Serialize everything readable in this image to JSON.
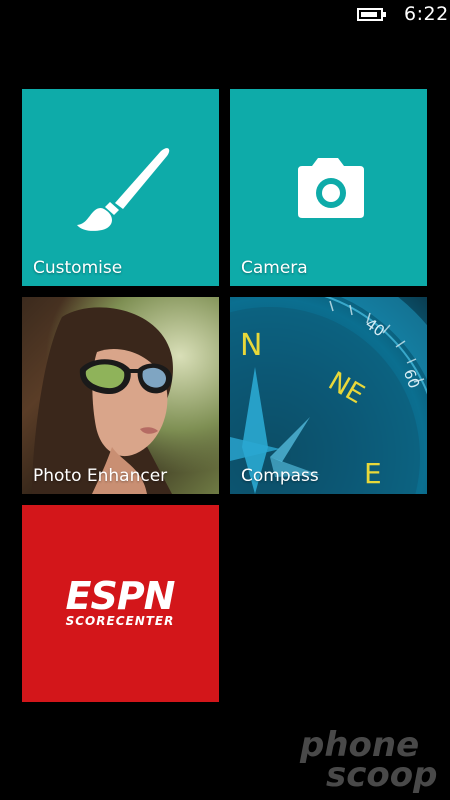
{
  "status_bar": {
    "time": "6:22",
    "battery_icon": "battery-icon"
  },
  "tiles": [
    {
      "label": "Customise",
      "icon": "paintbrush-icon",
      "color": "#0eaba9"
    },
    {
      "label": "Camera",
      "icon": "camera-icon",
      "color": "#0eaba9"
    },
    {
      "label": "Photo Enhancer",
      "icon": "photo-enhancer-image"
    },
    {
      "label": "Compass",
      "icon": "compass-image"
    },
    {
      "label": "",
      "icon": "espn-scorecenter-logo",
      "color": "#d3161a"
    }
  ],
  "espn": {
    "brand": "ESPN",
    "sub": "SCORECENTER"
  },
  "compass": {
    "n": "N",
    "ne": "NE",
    "e": "E",
    "deg40": "40",
    "deg60": "60"
  },
  "watermark": {
    "line1": "phone",
    "line2": "scoop"
  }
}
